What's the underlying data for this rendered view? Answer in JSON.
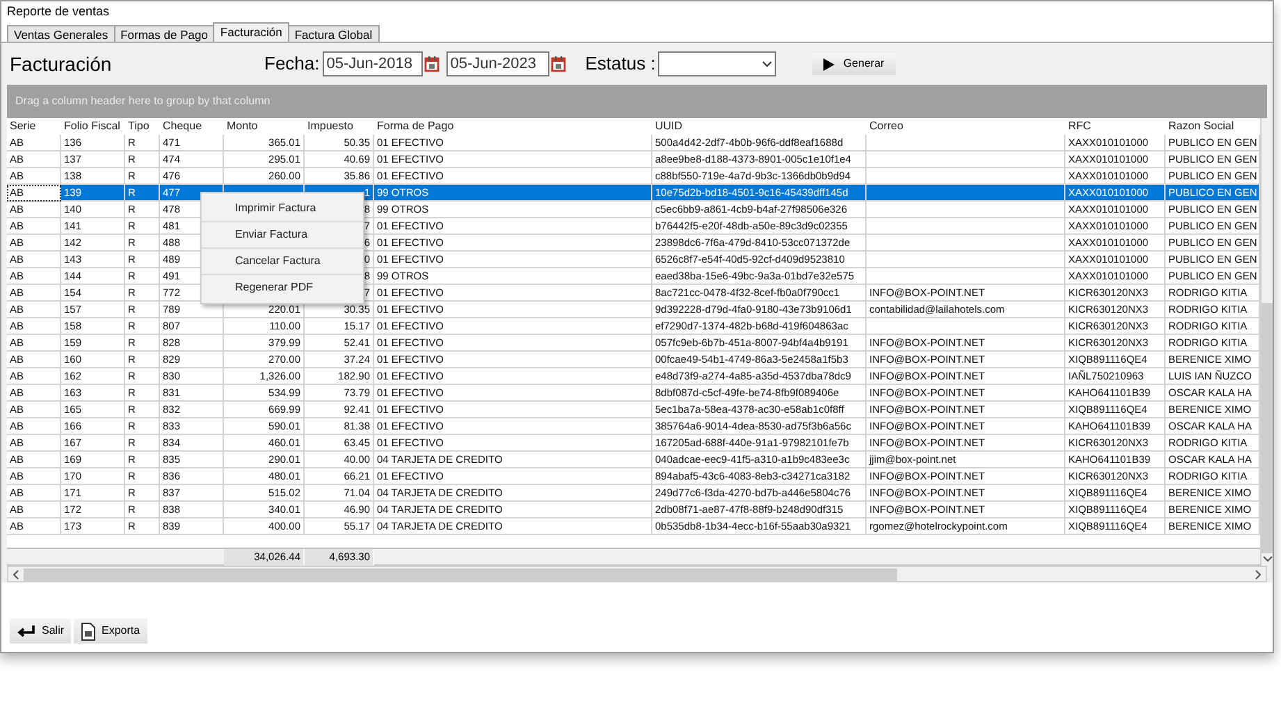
{
  "window": {
    "title": "Reporte de ventas"
  },
  "tabs": [
    {
      "label": "Ventas Generales",
      "selected": false
    },
    {
      "label": "Formas de Pago",
      "selected": false
    },
    {
      "label": "Facturación",
      "selected": true
    },
    {
      "label": "Factura Global",
      "selected": false
    }
  ],
  "heading": "Facturación",
  "filters": {
    "date_label": "Fecha:",
    "date_from": "05-Jun-2018",
    "date_to": "05-Jun-2023",
    "status_label": "Estatus :",
    "generate_button": "Generar"
  },
  "group_panel": "Drag a column header here to group by that column",
  "table": {
    "columns": [
      "Serie",
      "Folio Fiscal",
      "Tipo",
      "Cheque",
      "Monto",
      "Impuesto",
      "Forma de Pago",
      "UUID",
      "Correo",
      "RFC",
      "Razon Social"
    ],
    "rows": [
      {
        "selected": false,
        "cells": [
          "AB",
          "136",
          "R",
          "471",
          "365.01",
          "50.35",
          "01 EFECTIVO",
          "500a4d42-2df7-4b0b-96f6-ddf8eaf1688d",
          null,
          "XAXX010101000",
          "PUBLICO EN GEN"
        ]
      },
      {
        "selected": false,
        "cells": [
          "AB",
          "137",
          "R",
          "474",
          "295.01",
          "40.69",
          "01 EFECTIVO",
          "a8ee9be8-d188-4373-8901-005c1e10f1e4",
          null,
          "XAXX010101000",
          "PUBLICO EN GEN"
        ]
      },
      {
        "selected": false,
        "cells": [
          "AB",
          "138",
          "R",
          "476",
          "260.00",
          "35.86",
          "01 EFECTIVO",
          "c88bf550-719e-4a7d-9b3c-1366db0b9d94",
          null,
          "XAXX010101000",
          "PUBLICO EN GEN"
        ]
      },
      {
        "selected": true,
        "cells": [
          "AB",
          "139",
          "R",
          "477",
          null,
          "1",
          "99 OTROS",
          "10e75d2b-bd18-4501-9c16-45439dff145d",
          null,
          "XAXX010101000",
          "PUBLICO EN GEN"
        ]
      },
      {
        "selected": false,
        "cells": [
          "AB",
          "140",
          "R",
          "478",
          null,
          "8",
          "99 OTROS",
          "c5ec6bb9-a861-4cb9-b4af-27f98506e326",
          null,
          "XAXX010101000",
          "PUBLICO EN GEN"
        ]
      },
      {
        "selected": false,
        "cells": [
          "AB",
          "141",
          "R",
          "481",
          null,
          "7",
          "01 EFECTIVO",
          "b76442f5-e20f-48db-a50e-89c3d9c02355",
          null,
          "XAXX010101000",
          "PUBLICO EN GEN"
        ]
      },
      {
        "selected": false,
        "cells": [
          "AB",
          "142",
          "R",
          "488",
          null,
          "6",
          "01 EFECTIVO",
          "23898dc6-7f6a-479d-8410-53cc071372de",
          null,
          "XAXX010101000",
          "PUBLICO EN GEN"
        ]
      },
      {
        "selected": false,
        "cells": [
          "AB",
          "143",
          "R",
          "489",
          null,
          "0",
          "01 EFECTIVO",
          "6526c8f7-e54f-40d5-92cf-d409d9523810",
          null,
          "XAXX010101000",
          "PUBLICO EN GEN"
        ]
      },
      {
        "selected": false,
        "cells": [
          "AB",
          "144",
          "R",
          "491",
          null,
          "8",
          "99 OTROS",
          "eaed38ba-15e6-49bc-9a3a-01bd7e32e575",
          null,
          "XAXX010101000",
          "PUBLICO EN GEN"
        ]
      },
      {
        "selected": false,
        "cells": [
          "AB",
          "154",
          "R",
          "772",
          null,
          "7",
          "01 EFECTIVO",
          "8ac721cc-0478-4f32-8cef-fb0a0f790cc1",
          "INFO@BOX-POINT.NET",
          "KICR630120NX3",
          "RODRIGO KITIA"
        ]
      },
      {
        "selected": false,
        "cells": [
          "AB",
          "157",
          "R",
          "789",
          "220.01",
          "30.35",
          "01 EFECTIVO",
          "9d392228-d79d-4fa0-9180-43e73b9106d1",
          "contabilidad@lailahotels.com",
          "KICR630120NX3",
          "RODRIGO KITIA"
        ]
      },
      {
        "selected": false,
        "cells": [
          "AB",
          "158",
          "R",
          "807",
          "110.00",
          "15.17",
          "01 EFECTIVO",
          "ef7290d7-1374-482b-b68d-419f604863ac",
          null,
          "KICR630120NX3",
          "RODRIGO KITIA"
        ]
      },
      {
        "selected": false,
        "cells": [
          "AB",
          "159",
          "R",
          "828",
          "379.99",
          "52.41",
          "01 EFECTIVO",
          "057fc9eb-6b7b-451a-8007-94bf4a4b9191",
          "INFO@BOX-POINT.NET",
          "KICR630120NX3",
          "RODRIGO KITIA"
        ]
      },
      {
        "selected": false,
        "cells": [
          "AB",
          "160",
          "R",
          "829",
          "270.00",
          "37.24",
          "01 EFECTIVO",
          "00fcae49-54b1-4749-86a3-5e2458a1f5b3",
          "INFO@BOX-POINT.NET",
          "XIQB891116QE4",
          "BERENICE XIMO"
        ]
      },
      {
        "selected": false,
        "cells": [
          "AB",
          "162",
          "R",
          "830",
          "1,326.00",
          "182.90",
          "01 EFECTIVO",
          "e48d73f9-a274-4a85-a35d-4537dba78dc9",
          "INFO@BOX-POINT.NET",
          "IAÑL750210963",
          "LUIS IAN ÑUZCO"
        ]
      },
      {
        "selected": false,
        "cells": [
          "AB",
          "163",
          "R",
          "831",
          "534.99",
          "73.79",
          "01 EFECTIVO",
          "8dbf087d-c5cf-49fe-be74-8fb9f089406e",
          "INFO@BOX-POINT.NET",
          "KAHO641101B39",
          "OSCAR KALA HA"
        ]
      },
      {
        "selected": false,
        "cells": [
          "AB",
          "165",
          "R",
          "832",
          "669.99",
          "92.41",
          "01 EFECTIVO",
          "5ec1ba7a-58ea-4378-ac30-e58ab1c0f8ff",
          "INFO@BOX-POINT.NET",
          "XIQB891116QE4",
          "BERENICE XIMO"
        ]
      },
      {
        "selected": false,
        "cells": [
          "AB",
          "166",
          "R",
          "833",
          "590.01",
          "81.38",
          "01 EFECTIVO",
          "385764a6-9014-4dea-8530-ad75f3b6a56c",
          "INFO@BOX-POINT.NET",
          "KAHO641101B39",
          "OSCAR KALA HA"
        ]
      },
      {
        "selected": false,
        "cells": [
          "AB",
          "167",
          "R",
          "834",
          "460.01",
          "63.45",
          "01 EFECTIVO",
          "167205ad-688f-440e-91a1-97982101fe7b",
          "INFO@BOX-POINT.NET",
          "KICR630120NX3",
          "RODRIGO KITIA"
        ]
      },
      {
        "selected": false,
        "cells": [
          "AB",
          "169",
          "R",
          "835",
          "290.01",
          "40.00",
          "04 TARJETA DE CREDITO",
          "040adcae-eec9-41f5-a310-a1b9c483ee3c",
          "jjim@box-point.net",
          "KAHO641101B39",
          "OSCAR KALA HA"
        ]
      },
      {
        "selected": false,
        "cells": [
          "AB",
          "170",
          "R",
          "836",
          "480.01",
          "66.21",
          "01 EFECTIVO",
          "894abaf5-43c6-4083-8eb3-c34271ca3182",
          "INFO@BOX-POINT.NET",
          "KICR630120NX3",
          "RODRIGO KITIA"
        ]
      },
      {
        "selected": false,
        "cells": [
          "AB",
          "171",
          "R",
          "837",
          "515.02",
          "71.04",
          "04 TARJETA DE CREDITO",
          "249d77c6-f3da-4270-bd7b-a446e5804c76",
          "INFO@BOX-POINT.NET",
          "XIQB891116QE4",
          "BERENICE XIMO"
        ]
      },
      {
        "selected": false,
        "cells": [
          "AB",
          "172",
          "R",
          "838",
          "340.01",
          "46.90",
          "04 TARJETA DE CREDITO",
          "2db08f71-ae87-47f8-88f9-b248d90df315",
          "INFO@BOX-POINT.NET",
          "XIQB891116QE4",
          "BERENICE XIMO"
        ]
      },
      {
        "selected": false,
        "cells": [
          "AB",
          "173",
          "R",
          "839",
          "400.00",
          "55.17",
          "04 TARJETA DE CREDITO",
          "0b535db8-1b34-4ecc-b16f-55aab30a9321",
          "rgomez@hotelrockypoint.com",
          "XIQB891116QE4",
          "BERENICE XIMO"
        ]
      }
    ],
    "totals": {
      "monto": "34,026.44",
      "impuesto": "4,693.30"
    }
  },
  "context_menu": [
    "Imprimir Factura",
    "Enviar Factura",
    "Cancelar Factura",
    "Regenerar PDF"
  ],
  "footer_buttons": [
    {
      "kind": "exit",
      "label": "Salir"
    },
    {
      "kind": "export",
      "label": "Exporta"
    }
  ]
}
